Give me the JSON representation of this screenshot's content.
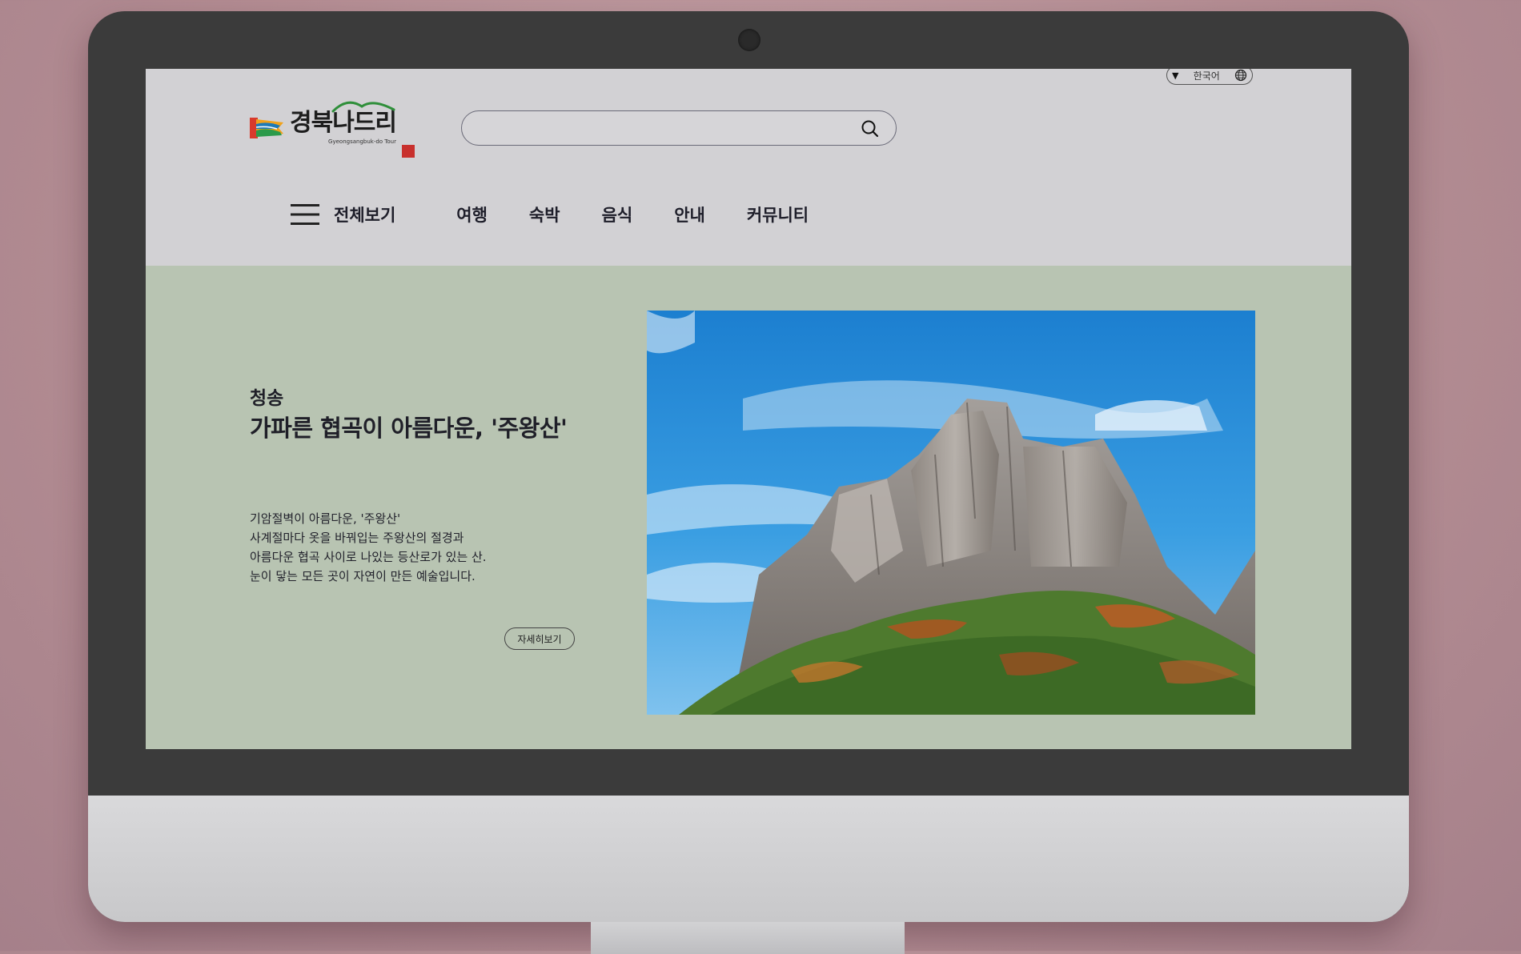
{
  "header": {
    "logo_text": "경북나드리",
    "logo_subtitle": "Gyeongsangbuk-do Tour",
    "language_label": "한국어",
    "search_placeholder": ""
  },
  "nav": {
    "menu_label": "전체보기",
    "items": [
      {
        "label": "여행"
      },
      {
        "label": "숙박"
      },
      {
        "label": "음식"
      },
      {
        "label": "안내"
      },
      {
        "label": "커뮤니티"
      }
    ]
  },
  "hero": {
    "region": "청송",
    "title": "가파른 협곡이 아름다운, '주왕산'",
    "description": [
      "기암절벽이 아름다운, '주왕산'",
      "사계절마다 옷을 바꿔입는 주왕산의 절경과",
      "아름다운 협곡 사이로 나있는 등산로가 있는 산.",
      "눈이 닿는 모든 곳이 자연이 만든 예술입니다."
    ],
    "detail_button": "자세히보기",
    "image_subject": "rocky mountain peak with autumn forest under blue sky"
  },
  "colors": {
    "page_bg": "#d2d1d4",
    "hero_bg": "#b8c4b2",
    "text_dark": "#1e1e2a",
    "bezel": "#3b3b3b"
  }
}
